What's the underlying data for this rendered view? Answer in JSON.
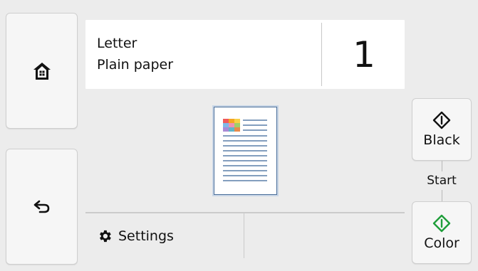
{
  "paper": {
    "size": "Letter",
    "type": "Plain paper"
  },
  "copies": "1",
  "settings": {
    "label": "Settings"
  },
  "start": {
    "label": "Start",
    "black_label": "Black",
    "color_label": "Color"
  },
  "icons": {
    "home": "home-icon",
    "back": "back-arrow-icon",
    "settings": "gear-icon",
    "start_black": "diamond-start-icon",
    "start_color": "diamond-start-icon"
  },
  "colors": {
    "background": "#ececec",
    "panel": "#ffffff",
    "button": "#f6f6f6",
    "color_start": "#1e9e3a",
    "black_start": "#111111",
    "preview_border": "#4a6e99"
  }
}
